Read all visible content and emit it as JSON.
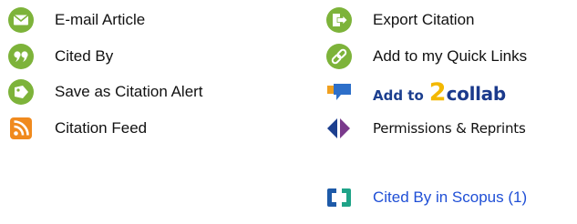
{
  "tools_left": [
    {
      "label": "E-mail Article",
      "icon": "envelope-icon"
    },
    {
      "label": "Cited By",
      "icon": "quote-icon"
    },
    {
      "label": "Save as Citation Alert",
      "icon": "tag-icon"
    },
    {
      "label": "Citation Feed",
      "icon": "rss-feed-icon"
    }
  ],
  "tools_right": [
    {
      "label": "Export Citation",
      "icon": "export-icon"
    },
    {
      "label": "Add to my Quick Links",
      "icon": "link-icon"
    },
    {
      "label_prefix": "Add to",
      "brand_mark": "2",
      "brand_word": "collab",
      "icon": "chat-bubble-icon"
    },
    {
      "label": "Permissions & Reprints",
      "icon": "diamond-arrow-icon"
    },
    {
      "label": "Cited By in Scopus (1)",
      "icon": "scopus-icon"
    }
  ],
  "colors": {
    "icon_green": "#7db33a",
    "rss_orange": "#f08a1e",
    "link_blue": "#1f4fd6",
    "collab_yellow": "#f3b800",
    "collab_navy": "#1b3a8c"
  }
}
